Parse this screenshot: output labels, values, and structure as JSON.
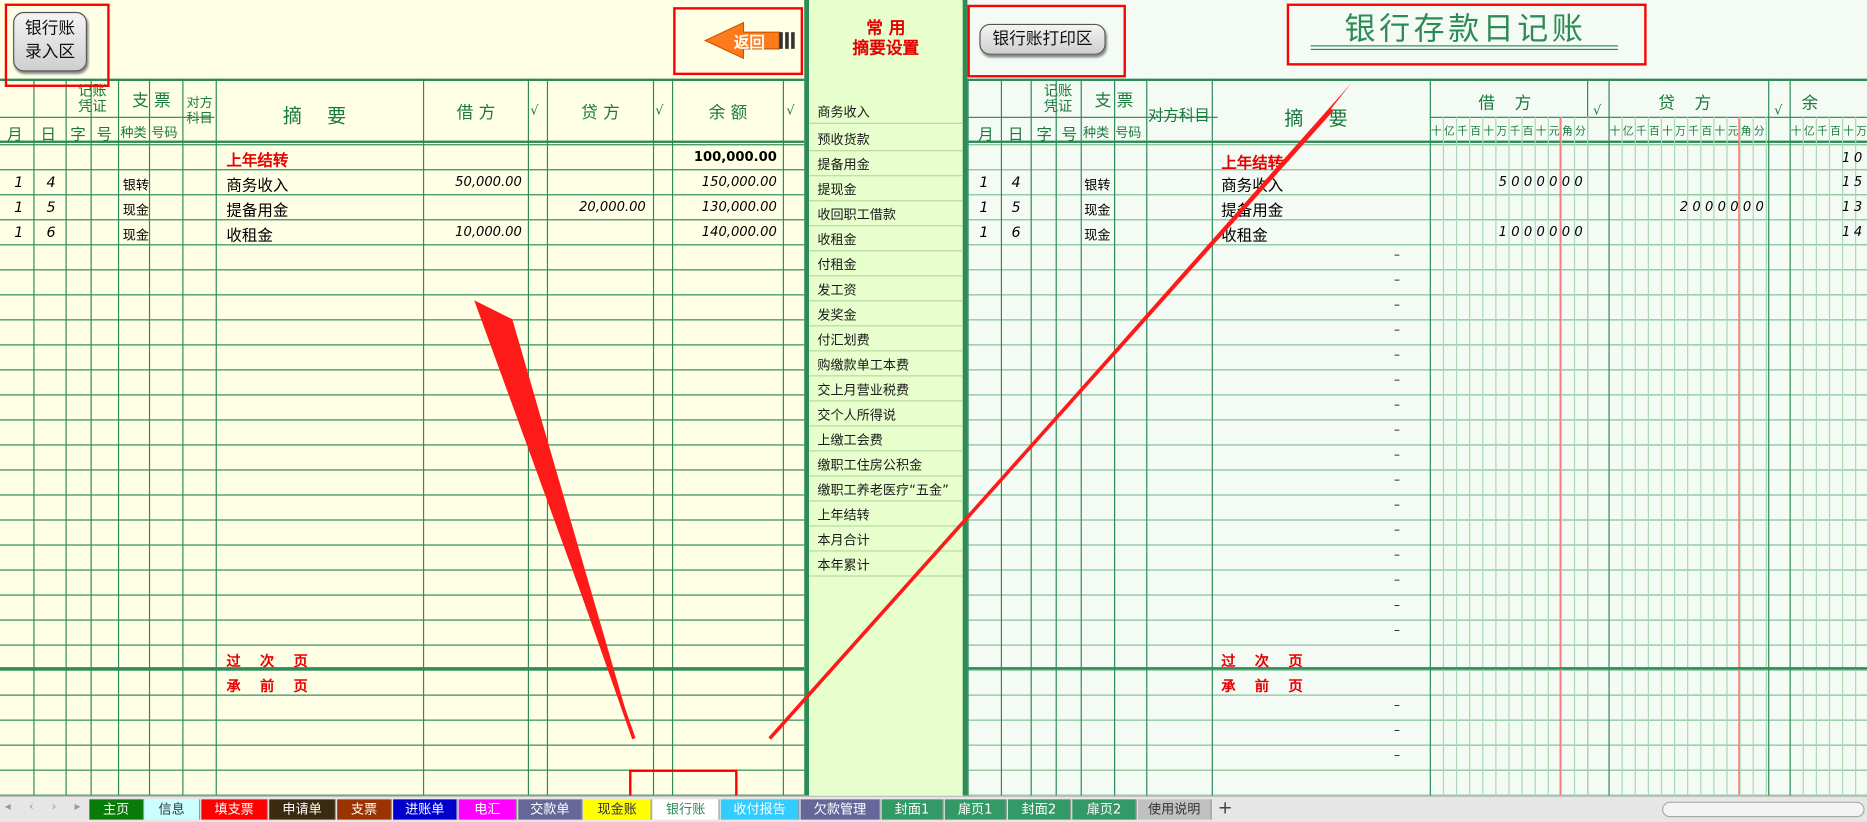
{
  "entry_button": {
    "line1": "银行账",
    "line2": "录入区"
  },
  "back_button": {
    "label": "返回"
  },
  "summary_header": {
    "line1": "常 用",
    "line2": "摘要设置"
  },
  "print_button": {
    "label": "银行账打印区"
  },
  "print_title": "银行存款日记账",
  "left_headers": {
    "voucher": "记账\n凭证",
    "month": "月",
    "day": "日",
    "zi": "字",
    "hao": "号",
    "cheque": "支 票",
    "type": "种类",
    "code": "号码",
    "contra": "对方\n科目",
    "summary": "摘 要",
    "debit": "借 方",
    "check": "√",
    "credit": "贷 方",
    "balance": "余 额"
  },
  "right_headers": {
    "contra": "对方科目",
    "debit": "借 方",
    "credit": "贷 方",
    "balance": "余",
    "digits": [
      "十",
      "亿",
      "千",
      "百",
      "十",
      "万",
      "千",
      "百",
      "十",
      "元",
      "角",
      "分"
    ]
  },
  "rows": [
    {
      "month": "",
      "day": "",
      "type": "",
      "summary": "上年结转",
      "debit": "",
      "credit": "",
      "balance": "100,000.00"
    },
    {
      "month": "1",
      "day": "4",
      "type": "银转",
      "summary": "商务收入",
      "debit": "50,000.00",
      "credit": "",
      "balance": "150,000.00"
    },
    {
      "month": "1",
      "day": "5",
      "type": "现金",
      "summary": "提备用金",
      "debit": "",
      "credit": "20,000.00",
      "balance": "130,000.00"
    },
    {
      "month": "1",
      "day": "6",
      "type": "现金",
      "summary": "收租金",
      "debit": "10,000.00",
      "credit": "",
      "balance": "140,000.00"
    }
  ],
  "carry_next": "过 次 页",
  "carry_prev": "承 前 页",
  "right_rows": [
    {
      "month": "1",
      "day": "4",
      "type": "银转",
      "summary": "商务收入",
      "debit_digits": "5000000",
      "credit_digits": "",
      "bal": "15"
    },
    {
      "month": "1",
      "day": "5",
      "type": "现金",
      "summary": "提备用金",
      "debit_digits": "",
      "credit_digits": "2000000",
      "bal": "13"
    },
    {
      "month": "1",
      "day": "6",
      "type": "现金",
      "summary": "收租金",
      "debit_digits": "1000000",
      "credit_digits": "",
      "bal": "14"
    }
  ],
  "right_first": {
    "summary": "上年结转",
    "bal": "10"
  },
  "dash": "–",
  "summary_list": [
    "商务收入",
    "预收货款",
    "提备用金",
    "提现金",
    "收回职工借款",
    "收租金",
    "付租金",
    "发工资",
    "发奖金",
    "付汇划费",
    "购缴款单工本费",
    "交上月营业税费",
    "交个人所得说",
    "上缴工会费",
    "缴职工住房公积金",
    "缴职工养老医疗“五金”",
    "上年结转",
    "本月合计",
    "本年累计"
  ],
  "tabs": [
    {
      "label": "主页",
      "bg": "#0a7a0a",
      "fg": "#ffffff"
    },
    {
      "label": "信息",
      "bg": "#ccffff",
      "fg": "#333333"
    },
    {
      "label": "填支票",
      "bg": "#ff0000",
      "fg": "#ffffff"
    },
    {
      "label": "申请单",
      "bg": "#3a2a10",
      "fg": "#ffffff"
    },
    {
      "label": "支票",
      "bg": "#993300",
      "fg": "#ffffff"
    },
    {
      "label": "进账单",
      "bg": "#0000cc",
      "fg": "#ffffff"
    },
    {
      "label": "电汇",
      "bg": "#ff00ff",
      "fg": "#ffffff"
    },
    {
      "label": "交款单",
      "bg": "#666699",
      "fg": "#ffffff"
    },
    {
      "label": "现金账",
      "bg": "#ffff00",
      "fg": "#333333"
    },
    {
      "label": "银行账",
      "bg": "#ffffff",
      "fg": "#2e8b57"
    },
    {
      "label": "收付报告",
      "bg": "#33ccff",
      "fg": "#ffffff"
    },
    {
      "label": "欠款管理",
      "bg": "#666699",
      "fg": "#ffffff"
    },
    {
      "label": "封面1",
      "bg": "#339966",
      "fg": "#ffffff"
    },
    {
      "label": "扉页1",
      "bg": "#339966",
      "fg": "#ffffff"
    },
    {
      "label": "封面2",
      "bg": "#339966",
      "fg": "#ffffff"
    },
    {
      "label": "扉页2",
      "bg": "#339966",
      "fg": "#ffffff"
    },
    {
      "label": "使用说明",
      "bg": "#c0c0c0",
      "fg": "#333333"
    }
  ],
  "add_tab": "+",
  "colors": {
    "grid": "#2e8b57",
    "accent_red": "#e60000",
    "sheet_bg": "#ffffe5",
    "summary_bg": "#e6ffcc"
  }
}
